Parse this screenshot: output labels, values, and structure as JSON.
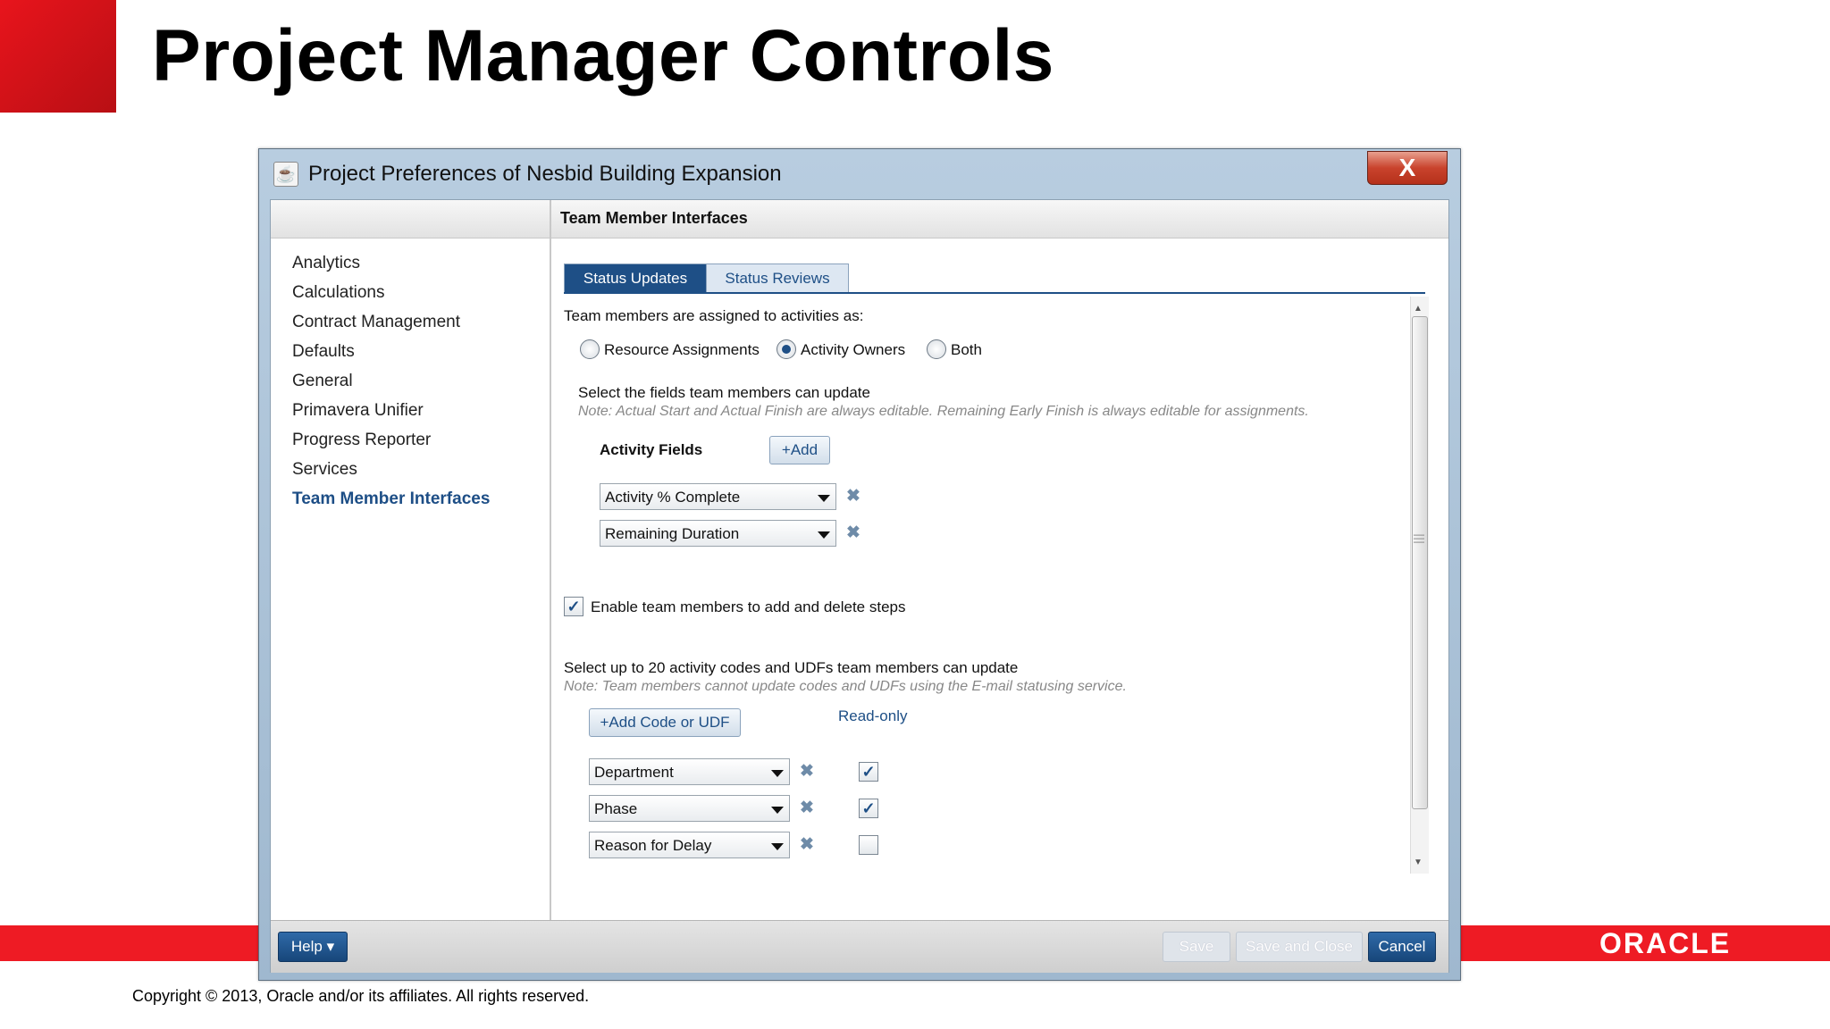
{
  "slide": {
    "title": "Project Manager Controls",
    "copyright": "Copyright © 2013, Oracle and/or its affiliates. All rights reserved.",
    "logo_text": "ORACLE"
  },
  "window": {
    "title": "Project Preferences of Nesbid Building Expansion",
    "close_label": "X"
  },
  "nav": {
    "items": [
      {
        "label": "Analytics"
      },
      {
        "label": "Calculations"
      },
      {
        "label": "Contract Management"
      },
      {
        "label": "Defaults"
      },
      {
        "label": "General"
      },
      {
        "label": "Primavera Unifier"
      },
      {
        "label": "Progress Reporter"
      },
      {
        "label": "Services"
      },
      {
        "label": "Team Member Interfaces",
        "active": true
      }
    ]
  },
  "pane": {
    "title": "Team Member Interfaces",
    "tabs": [
      {
        "label": "Status Updates",
        "active": true
      },
      {
        "label": "Status Reviews",
        "active": false
      }
    ]
  },
  "status_updates": {
    "assign_label": "Team members are assigned to activities as:",
    "radios": [
      {
        "label": "Resource Assignments",
        "selected": false
      },
      {
        "label": "Activity Owners",
        "selected": true
      },
      {
        "label": "Both",
        "selected": false
      }
    ],
    "fields_label": "Select the fields team members can update",
    "fields_note": "Note: Actual Start and Actual Finish are always editable. Remaining Early Finish is always editable for assignments.",
    "activity_fields_label": "Activity Fields",
    "add_label": "+Add",
    "activity_fields": [
      {
        "value": "Activity % Complete"
      },
      {
        "value": "Remaining Duration"
      }
    ],
    "steps_checkbox": {
      "label": "Enable team members to add and delete steps",
      "checked": true
    },
    "codes_label": "Select up to 20 activity codes and UDFs team members can update",
    "codes_note": "Note: Team members cannot update codes and UDFs using the E-mail statusing service.",
    "add_code_label": "+Add Code or UDF",
    "readonly_label": "Read-only",
    "codes": [
      {
        "value": "Department",
        "read_only": true
      },
      {
        "value": "Phase",
        "read_only": true
      },
      {
        "value": "Reason for Delay",
        "read_only": false
      }
    ]
  },
  "footer": {
    "help_label": "Help",
    "save_label": "Save",
    "save_close_label": "Save and Close",
    "cancel_label": "Cancel"
  },
  "colors": {
    "oracle_red": "#ee1b24",
    "accent_blue": "#1e4f86"
  }
}
